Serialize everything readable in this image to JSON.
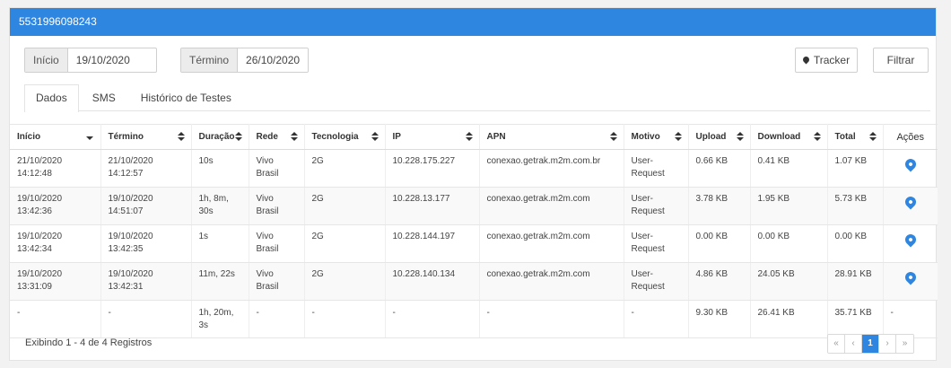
{
  "header": {
    "title": "5531996098243"
  },
  "filters": {
    "start_label": "Início",
    "start_value": "19/10/2020",
    "end_label": "Término",
    "end_value": "26/10/2020",
    "tracker_label": "Tracker",
    "filter_label": "Filtrar"
  },
  "tabs": [
    {
      "label": "Dados",
      "active": true
    },
    {
      "label": "SMS",
      "active": false
    },
    {
      "label": "Histórico de Testes",
      "active": false
    }
  ],
  "table": {
    "columns": [
      "Início",
      "Término",
      "Duração",
      "Rede",
      "Tecnologia",
      "IP",
      "APN",
      "Motivo",
      "Upload",
      "Download",
      "Total",
      "Ações"
    ],
    "rows": [
      {
        "inicio_date": "21/10/2020",
        "inicio_time": "14:12:48",
        "termino_date": "21/10/2020",
        "termino_time": "14:12:57",
        "duracao": "10s",
        "rede": "Vivo Brasil",
        "tecnologia": "2G",
        "ip": "10.228.175.227",
        "apn": "conexao.getrak.m2m.com.br",
        "motivo": "User-Request",
        "upload": "0.66 KB",
        "download": "0.41 KB",
        "total": "1.07 KB",
        "action_icon": "map-marker"
      },
      {
        "inicio_date": "19/10/2020",
        "inicio_time": "13:42:36",
        "termino_date": "19/10/2020",
        "termino_time": "14:51:07",
        "duracao": "1h, 8m, 30s",
        "rede": "Vivo Brasil",
        "tecnologia": "2G",
        "ip": "10.228.13.177",
        "apn": "conexao.getrak.m2m.com",
        "motivo": "User-Request",
        "upload": "3.78 KB",
        "download": "1.95 KB",
        "total": "5.73 KB",
        "action_icon": "map-marker"
      },
      {
        "inicio_date": "19/10/2020",
        "inicio_time": "13:42:34",
        "termino_date": "19/10/2020",
        "termino_time": "13:42:35",
        "duracao": "1s",
        "rede": "Vivo Brasil",
        "tecnologia": "2G",
        "ip": "10.228.144.197",
        "apn": "conexao.getrak.m2m.com",
        "motivo": "User-Request",
        "upload": "0.00 KB",
        "download": "0.00 KB",
        "total": "0.00 KB",
        "action_icon": "map-marker"
      },
      {
        "inicio_date": "19/10/2020",
        "inicio_time": "13:31:09",
        "termino_date": "19/10/2020",
        "termino_time": "13:42:31",
        "duracao": "11m, 22s",
        "rede": "Vivo Brasil",
        "tecnologia": "2G",
        "ip": "10.228.140.134",
        "apn": "conexao.getrak.m2m.com",
        "motivo": "User-Request",
        "upload": "4.86 KB",
        "download": "24.05 KB",
        "total": "28.91 KB",
        "action_icon": "map-marker"
      }
    ],
    "totals": {
      "inicio": "-",
      "termino": "-",
      "duracao": "1h, 20m, 3s",
      "rede": "-",
      "tecnologia": "-",
      "ip": "-",
      "apn": "-",
      "motivo": "-",
      "upload": "9.30 KB",
      "download": "26.41 KB",
      "total": "35.71 KB",
      "acoes": "-"
    }
  },
  "footer": {
    "records_text": "Exibindo 1 - 4 de 4 Registros",
    "pagination": {
      "first": "«",
      "prev": "‹",
      "current": "1",
      "next": "›",
      "last": "»"
    }
  },
  "colors": {
    "primary": "#2f86e0"
  }
}
